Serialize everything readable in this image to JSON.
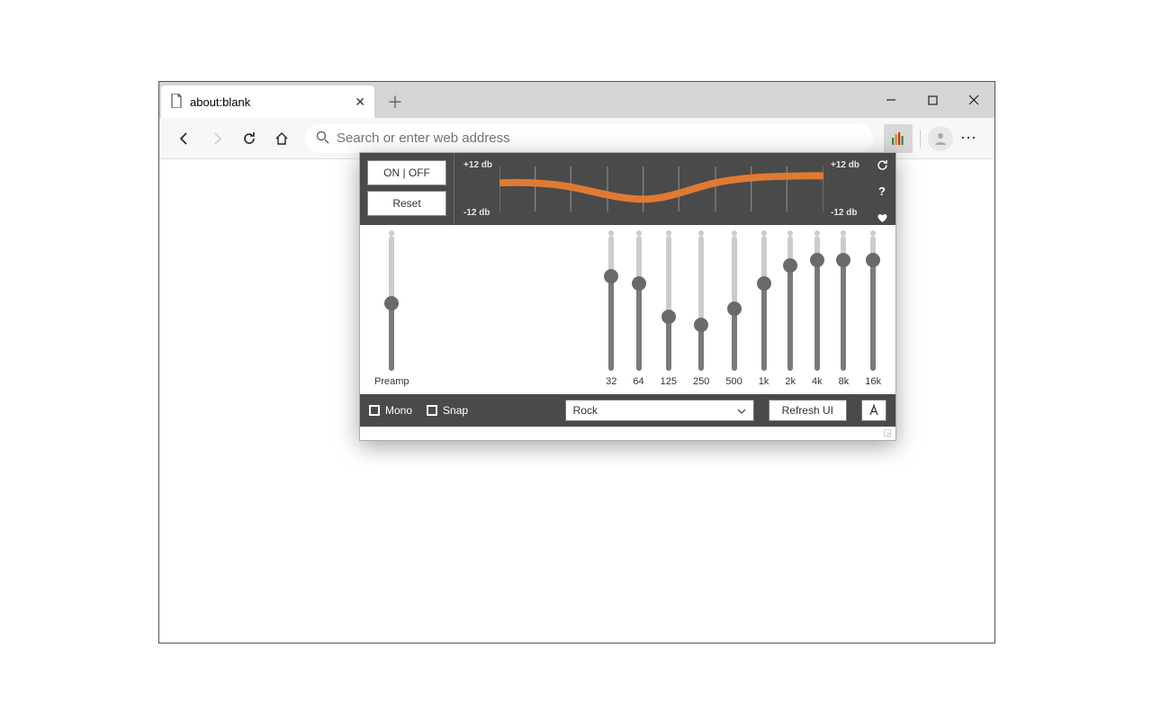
{
  "browser": {
    "tab_title": "about:blank",
    "address_placeholder": "Search or enter web address"
  },
  "eq": {
    "on_off_label": "ON | OFF",
    "reset_label": "Reset",
    "db_top": "+12  db",
    "db_bottom": "-12  db",
    "preamp_label": "Preamp",
    "bands": [
      {
        "label": "32",
        "value_pct": 70
      },
      {
        "label": "64",
        "value_pct": 65
      },
      {
        "label": "125",
        "value_pct": 40
      },
      {
        "label": "250",
        "value_pct": 34
      },
      {
        "label": "500",
        "value_pct": 46
      },
      {
        "label": "1k",
        "value_pct": 65
      },
      {
        "label": "2k",
        "value_pct": 78
      },
      {
        "label": "4k",
        "value_pct": 82
      },
      {
        "label": "8k",
        "value_pct": 82
      },
      {
        "label": "16k",
        "value_pct": 82
      }
    ],
    "preamp_value_pct": 50,
    "mono_label": "Mono",
    "snap_label": "Snap",
    "preset_selected": "Rock",
    "refresh_label": "Refresh UI"
  }
}
